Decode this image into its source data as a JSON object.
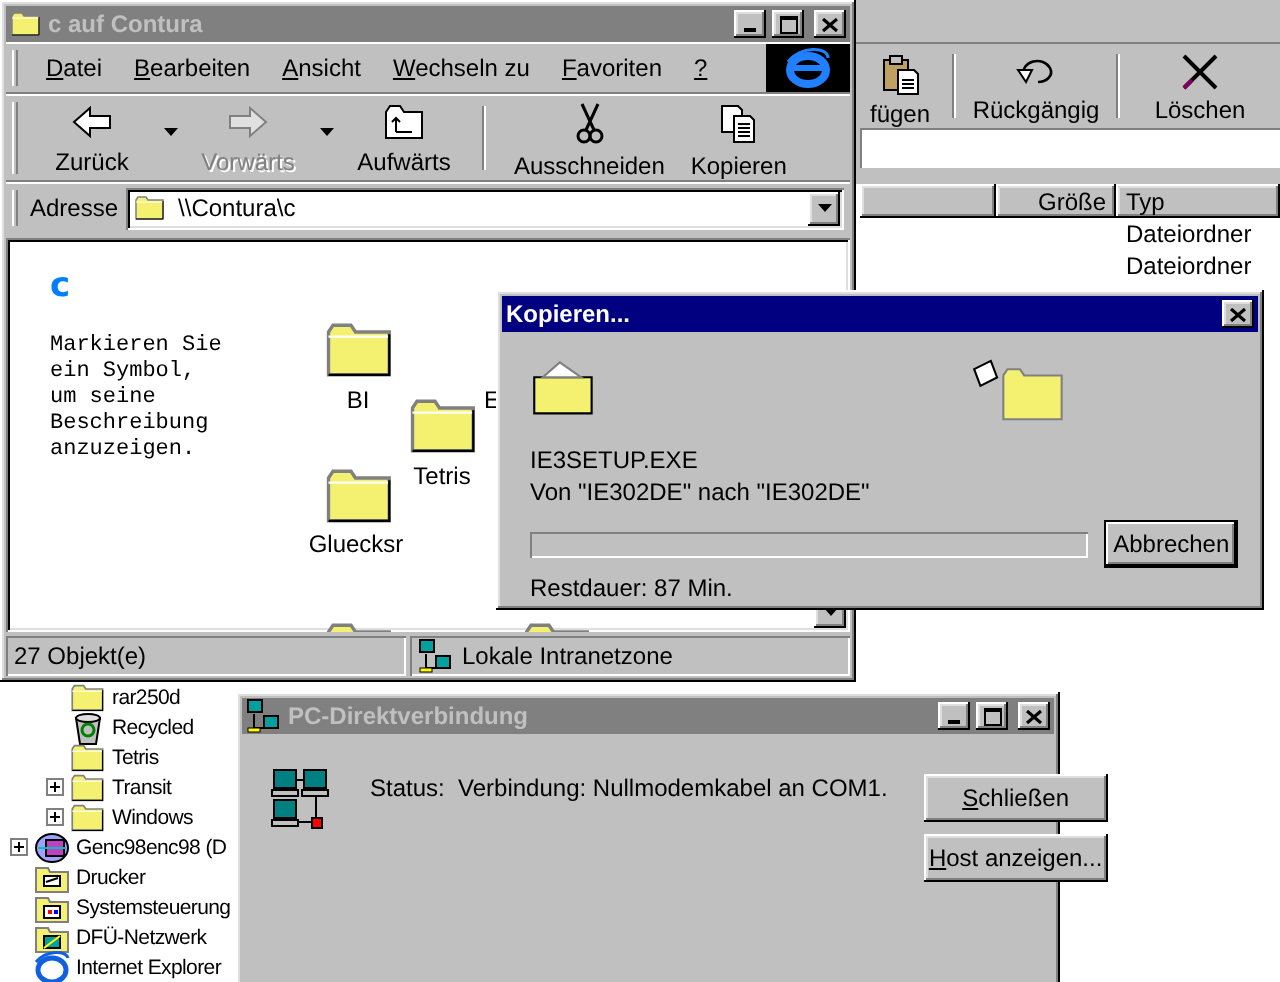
{
  "explorer_back": {
    "toolbar": [
      {
        "kind": "paste",
        "label": "fügen"
      },
      {
        "kind": "undo",
        "label": "Rückgängig"
      },
      {
        "kind": "delete",
        "label": "Löschen"
      }
    ],
    "columns": [
      {
        "label": "Größe"
      },
      {
        "label": "Typ"
      }
    ],
    "rows": [
      {
        "type": "Dateiordner"
      },
      {
        "type": "Dateiordner"
      }
    ],
    "tree": [
      {
        "children": [
          {
            "kind": "folder",
            "label": "rar250d"
          },
          {
            "kind": "recycle",
            "label": "Recycled"
          },
          {
            "kind": "folder",
            "label": "Tetris"
          },
          {
            "kind": "folder",
            "label": "Transit",
            "expanded": false
          },
          {
            "kind": "folder",
            "label": "Windows",
            "expanded": false
          }
        ]
      },
      {
        "kind": "drive",
        "label": "Genc98enc98 (D",
        "expanded": false
      },
      {
        "kind": "printers",
        "label": "Drucker"
      },
      {
        "kind": "control",
        "label": "Systemsteuerung"
      },
      {
        "kind": "dialup",
        "label": "DFÜ-Netzwerk"
      },
      {
        "kind": "ie",
        "label": "Internet Explorer"
      }
    ]
  },
  "folder_window": {
    "title": "c auf Contura",
    "active": false,
    "menu": [
      {
        "label": "Datei",
        "underline_first": true
      },
      {
        "label": "Bearbeiten",
        "underline_first": true
      },
      {
        "label": "Ansicht",
        "underline_first": true
      },
      {
        "label": "Wechseln zu",
        "underline_first": true
      },
      {
        "label": "Favoriten",
        "underline_first": true
      },
      {
        "label": "?",
        "underline_first": true
      }
    ],
    "toolbar": [
      {
        "kind": "back",
        "label": "Zurück",
        "disabled": false,
        "dropdown": true
      },
      {
        "kind": "forward",
        "label": "Vorwärts",
        "disabled": true,
        "dropdown": true
      },
      {
        "kind": "up",
        "label": "Aufwärts",
        "disabled": false,
        "dropdown": false
      },
      {
        "kind": "separator"
      },
      {
        "kind": "cut",
        "label": "Ausschneiden",
        "disabled": false,
        "dropdown": false
      },
      {
        "kind": "copy",
        "label": "Kopieren",
        "disabled": false,
        "dropdown": false
      }
    ],
    "address": {
      "label": "Adresse",
      "value": "\\\\Contura\\c"
    },
    "heading": "c",
    "description": "Markieren Sie ein Symbol, um seine Beschreibung anzuzeigen.",
    "icons": [
      {
        "kind": "folder",
        "label": "BI"
      },
      {
        "kind": "folder",
        "label": "Tetris"
      },
      {
        "kind": "label",
        "label": "E"
      },
      {
        "kind": "folder",
        "label": "Gluecksr"
      },
      {
        "kind": "folder"
      },
      {
        "kind": "folder"
      }
    ],
    "status": [
      "27 Objekt(e)",
      "Lokale Intranetzone"
    ]
  },
  "copy_dialog": {
    "title": "Kopieren...",
    "active": true,
    "file": "IE3SETUP.EXE",
    "from_to": "Von \"IE302DE\" nach \"IE302DE\"",
    "progress": {
      "level": 0
    },
    "remaining": "Restdauer: 87 Min.",
    "button": "Abbrechen"
  },
  "direct_cable_window": {
    "title": "PC-Direktverbindung",
    "active": false,
    "status": "Status:  Verbindung: Nullmodemkabel an COM1.",
    "buttons": [
      {
        "label": "Schließen",
        "underline_first": true
      },
      {
        "label": "Host anzeigen...",
        "underline_first": true
      }
    ]
  }
}
